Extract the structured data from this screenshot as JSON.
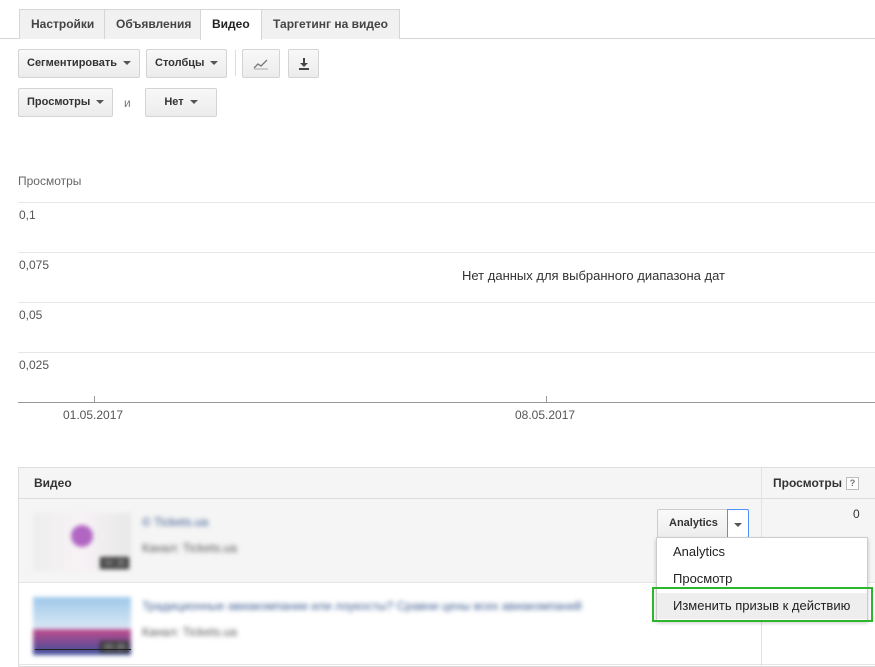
{
  "tabs": [
    "Настройки",
    "Объявления",
    "Видео",
    "Таргетинг на видео"
  ],
  "toolbar": {
    "segment_label": "Сегментировать",
    "columns_label": "Столбцы",
    "chart_icon": "line-chart-icon",
    "download_icon": "download-icon"
  },
  "filter": {
    "metric1": "Просмотры",
    "and_text": "и",
    "metric2": "Нет"
  },
  "chart": {
    "ylabel": "Просмотры",
    "yticks": [
      "0,1",
      "0,075",
      "0,05",
      "0,025"
    ],
    "xticks": [
      "01.05.2017",
      "08.05.2017"
    ],
    "no_data_text": "Нет данных для выбранного диапазона дат"
  },
  "chart_data": {
    "type": "line",
    "title": "",
    "ylabel": "Просмотры",
    "ylim": [
      0,
      0.1
    ],
    "x": [],
    "series": [],
    "yticks": [
      0.1,
      0.075,
      0.05,
      0.025
    ],
    "xtick_labels": [
      "01.05.2017",
      "08.05.2017"
    ],
    "grid": true
  },
  "table": {
    "col_video": "Видео",
    "col_views": "Просмотры",
    "help_glyph": "?",
    "rows": [
      {
        "title": "© Tickets.ua",
        "channel": "Канал: Tickets.ua",
        "duration": "00:35",
        "views": "0",
        "action_label": "Analytics"
      },
      {
        "title": "Традиционные авиакомпании или лоукосты? Сравни цены всех авиакомпаний",
        "channel": "Канал: Tickets.ua",
        "duration": "00:30",
        "views": ""
      }
    ]
  },
  "menu": {
    "items": [
      "Analytics",
      "Просмотр",
      "Изменить призыв к действию"
    ]
  },
  "colors": {
    "highlight": "#2db52d",
    "focus_border": "#4d90fe"
  }
}
